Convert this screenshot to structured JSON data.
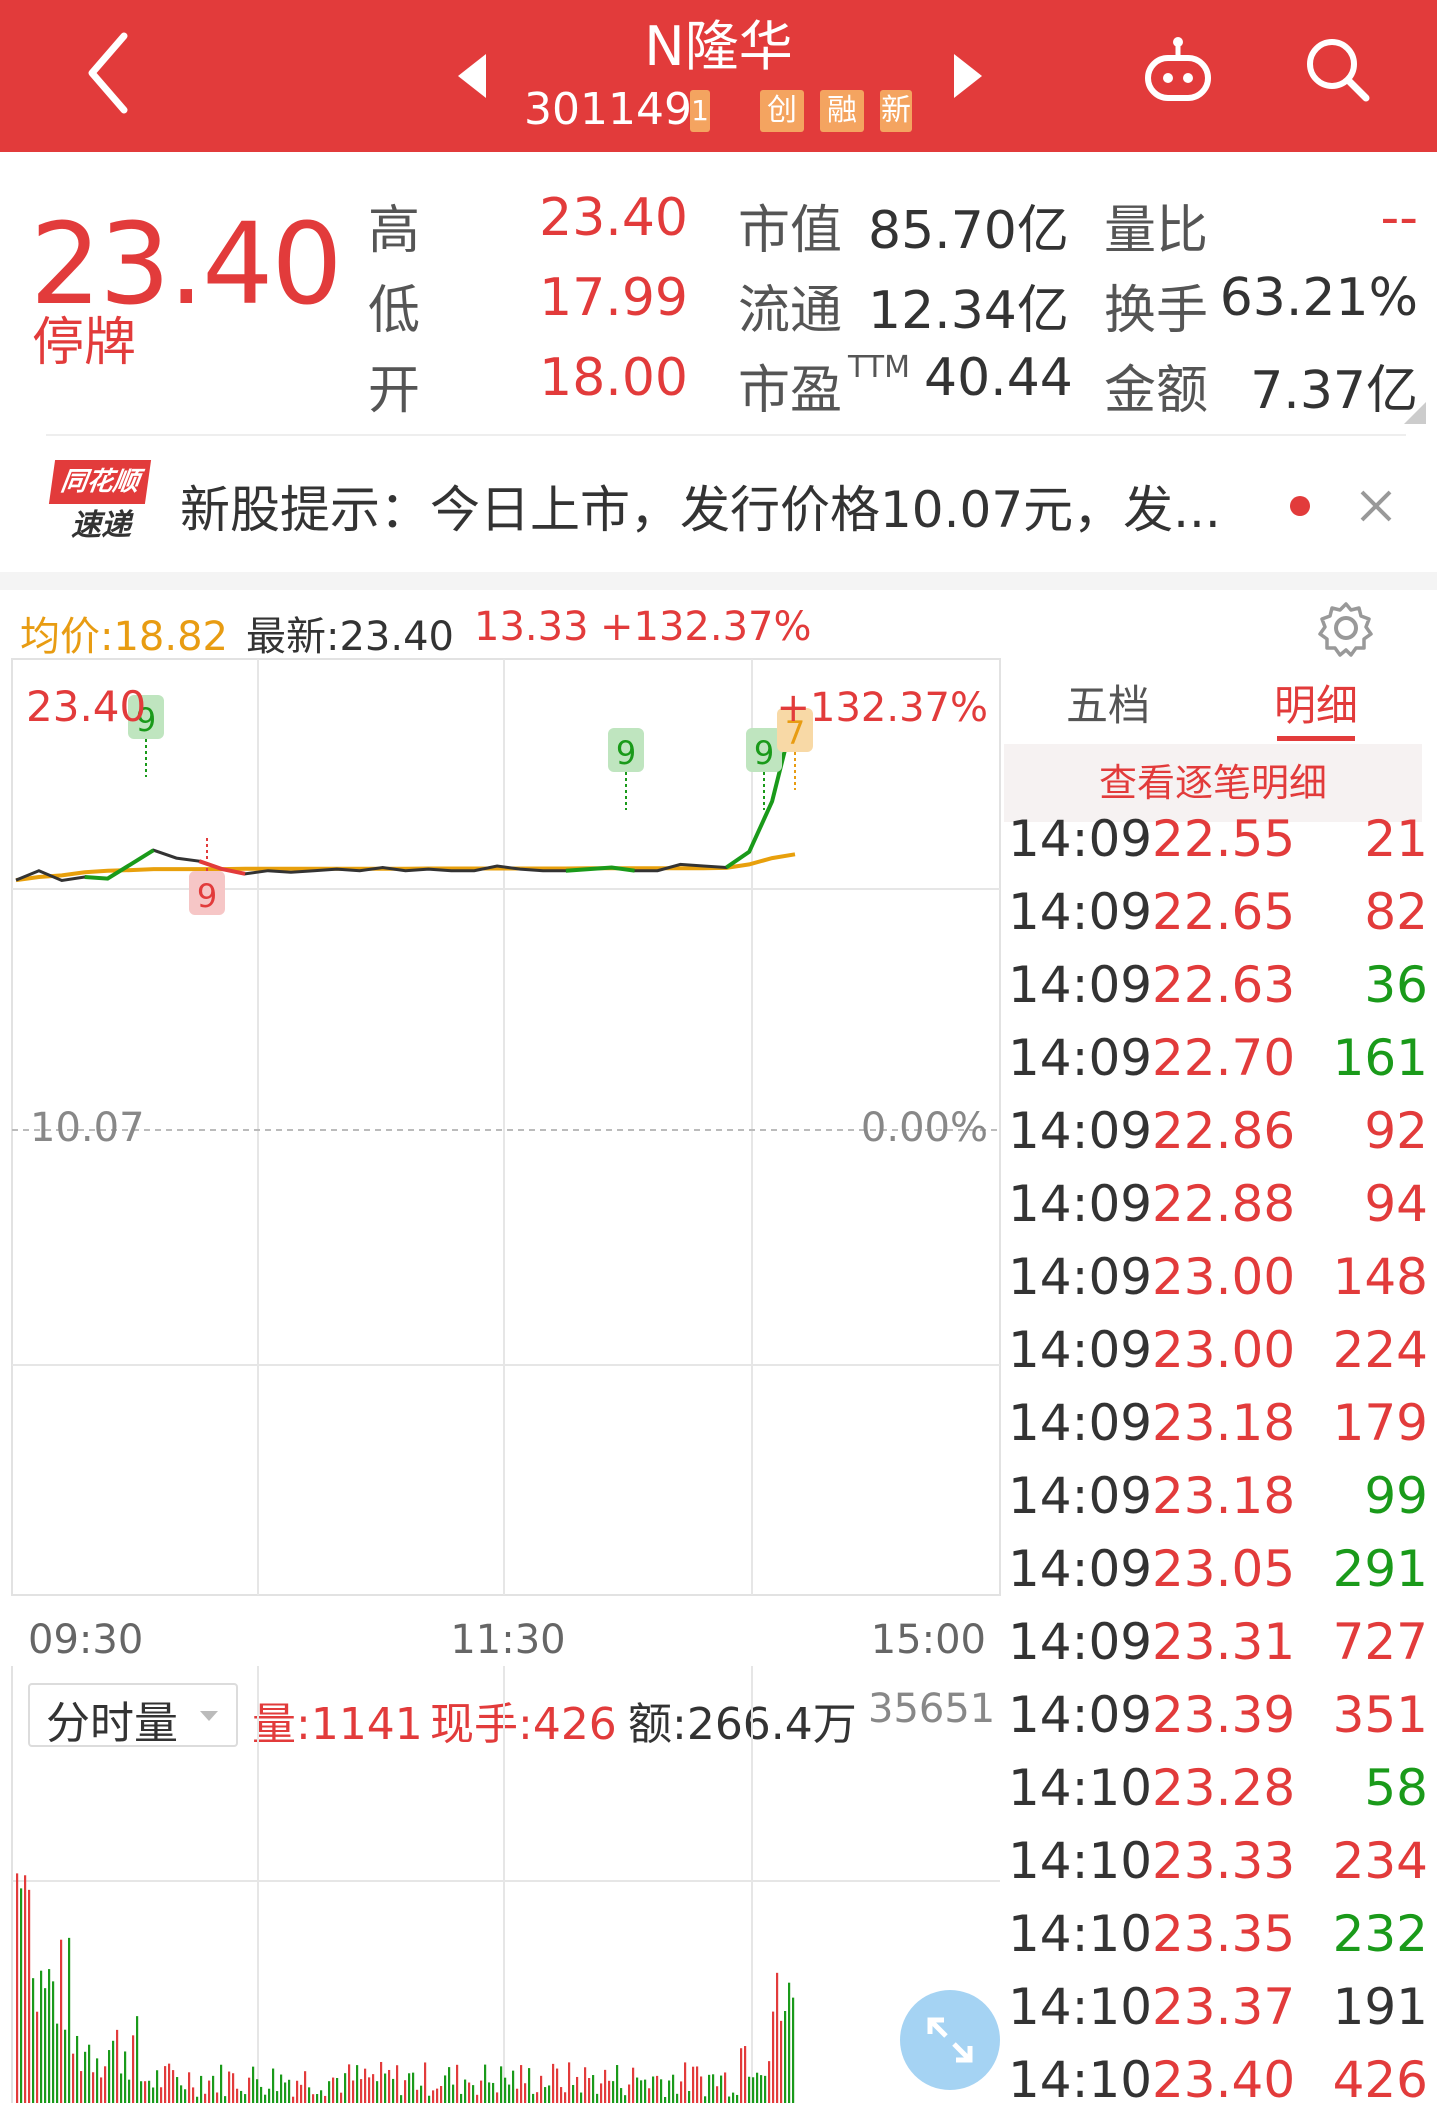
{
  "header": {
    "title": "N隆华",
    "code": "301149",
    "code_suffix": "1",
    "badges": [
      "创",
      "融",
      "新"
    ]
  },
  "quote": {
    "price": "23.40",
    "status": "停牌",
    "rows": [
      {
        "l1": "高",
        "v1": "23.40",
        "l2": "市值",
        "v2": "85.70亿",
        "l3": "量比",
        "v3": "--"
      },
      {
        "l1": "低",
        "v1": "17.99",
        "l2": "流通",
        "v2": "12.34亿",
        "l3": "换手",
        "v3": "63.21%"
      },
      {
        "l1": "开",
        "v1": "18.00",
        "l2": "市盈",
        "l2_sup": "TTM",
        "v2": "40.44",
        "l3": "金额",
        "v3": "7.37亿"
      }
    ]
  },
  "news": {
    "logo_top": "同花顺",
    "logo_bottom": "速递",
    "text": "新股提示：今日上市，发行价格10.07元，发..."
  },
  "chart_info": {
    "avg_label": "均价:18.82",
    "latest_label": "最新:23.40",
    "change": "13.33",
    "change_pct": "+132.37%"
  },
  "chart_data": {
    "type": "line",
    "y_top_label": "23.40",
    "y_mid_label": "10.07",
    "pct_top_label": "+132.37%",
    "pct_mid_label": "0.00%",
    "x_ticks": [
      "09:30",
      "11:30",
      "15:00"
    ],
    "series": [
      {
        "values": [
          18.0,
          18.3,
          17.99,
          18.1,
          18.05,
          18.5,
          18.95,
          18.7,
          18.6,
          18.35,
          18.2,
          18.3,
          18.25,
          18.3,
          18.35,
          18.3,
          18.4,
          18.3,
          18.35,
          18.3,
          18.3,
          18.45,
          18.35,
          18.3,
          18.3,
          18.35,
          18.4,
          18.3,
          18.3,
          18.5,
          18.45,
          18.4,
          18.9,
          20.5,
          23.4
        ]
      },
      {
        "values": [
          18.0,
          18.1,
          18.15,
          18.25,
          18.3,
          18.32,
          18.35,
          18.35,
          18.35,
          18.35,
          18.36,
          18.36,
          18.36,
          18.36,
          18.36,
          18.36,
          18.36,
          18.36,
          18.37,
          18.37,
          18.37,
          18.37,
          18.37,
          18.37,
          18.37,
          18.38,
          18.38,
          18.38,
          18.38,
          18.38,
          18.38,
          18.39,
          18.5,
          18.7,
          18.82
        ]
      }
    ],
    "markers": [
      "9",
      "9",
      "9",
      "9",
      "7"
    ]
  },
  "tabs": {
    "five": "五档",
    "detail": "明细",
    "detail_btn": "查看逐笔明细"
  },
  "trades": [
    {
      "time": "14:09",
      "price": "22.55",
      "vol": "21",
      "c": "#e23b3b"
    },
    {
      "time": "14:09",
      "price": "22.65",
      "vol": "82",
      "c": "#e23b3b"
    },
    {
      "time": "14:09",
      "price": "22.63",
      "vol": "36",
      "c": "#1a9a1a"
    },
    {
      "time": "14:09",
      "price": "22.70",
      "vol": "161",
      "c": "#1a9a1a"
    },
    {
      "time": "14:09",
      "price": "22.86",
      "vol": "92",
      "c": "#e23b3b"
    },
    {
      "time": "14:09",
      "price": "22.88",
      "vol": "94",
      "c": "#e23b3b"
    },
    {
      "time": "14:09",
      "price": "23.00",
      "vol": "148",
      "c": "#e23b3b"
    },
    {
      "time": "14:09",
      "price": "23.00",
      "vol": "224",
      "c": "#e23b3b"
    },
    {
      "time": "14:09",
      "price": "23.18",
      "vol": "179",
      "c": "#e23b3b"
    },
    {
      "time": "14:09",
      "price": "23.18",
      "vol": "99",
      "c": "#1a9a1a"
    },
    {
      "time": "14:09",
      "price": "23.05",
      "vol": "291",
      "c": "#1a9a1a"
    },
    {
      "time": "14:09",
      "price": "23.31",
      "vol": "727",
      "c": "#e23b3b"
    },
    {
      "time": "14:09",
      "price": "23.39",
      "vol": "351",
      "c": "#e23b3b"
    },
    {
      "time": "14:10",
      "price": "23.28",
      "vol": "58",
      "c": "#1a9a1a"
    },
    {
      "time": "14:10",
      "price": "23.33",
      "vol": "234",
      "c": "#e23b3b"
    },
    {
      "time": "14:10",
      "price": "23.35",
      "vol": "232",
      "c": "#1a9a1a"
    },
    {
      "time": "14:10",
      "price": "23.37",
      "vol": "191",
      "c": "#333333"
    },
    {
      "time": "14:10",
      "price": "23.40",
      "vol": "426",
      "c": "#e23b3b"
    }
  ],
  "volume": {
    "dropdown": "分时量",
    "vol": "量:1141",
    "hand": "现手:426",
    "amount": "额:266.4万",
    "max": "35651"
  }
}
